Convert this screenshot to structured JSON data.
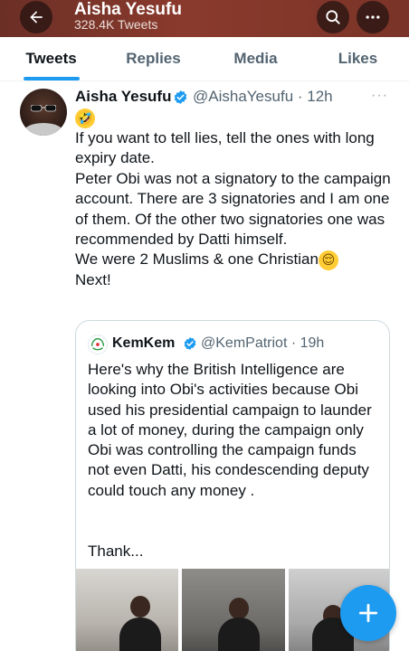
{
  "header": {
    "title": "Aisha Yesufu",
    "subtitle": "328.4K Tweets",
    "back_icon": "arrow-left-icon",
    "search_icon": "search-icon",
    "more_icon": "more-horizontal-icon"
  },
  "tabs": [
    {
      "label": "Tweets",
      "active": true
    },
    {
      "label": "Replies",
      "active": false
    },
    {
      "label": "Media",
      "active": false
    },
    {
      "label": "Likes",
      "active": false
    }
  ],
  "tweet": {
    "author_name": "Aisha Yesufu",
    "handle_time": "@AishaYesufu · 12h",
    "more_label": "···",
    "emoji_top": "🤣",
    "lines": [
      "If you want to tell lies, tell the ones with long expiry date.",
      "Peter Obi was not a signatory to the campaign account. There are 3 signatories and I am one of them. Of the other two signatories one was recommended by Datti himself.",
      "We were 2 Muslims & one Christian",
      "Next!"
    ],
    "emoji_inline": "😌"
  },
  "quote": {
    "author_name": "KemKem",
    "handle_time": "@KemPatriot · 19h",
    "text": "Here's why the British Intelligence are looking into Obi's activities because Obi used his presidential campaign to launder a lot of money, during the campaign only Obi was controlling the campaign funds not even Datti, his condescending deputy could touch any money .",
    "truncated": "Thank..."
  },
  "fab": {
    "icon": "plus-icon"
  },
  "colors": {
    "accent": "#1d9bf0",
    "header_bg": "#7a3428",
    "text": "#0f1419",
    "muted": "#536471"
  }
}
